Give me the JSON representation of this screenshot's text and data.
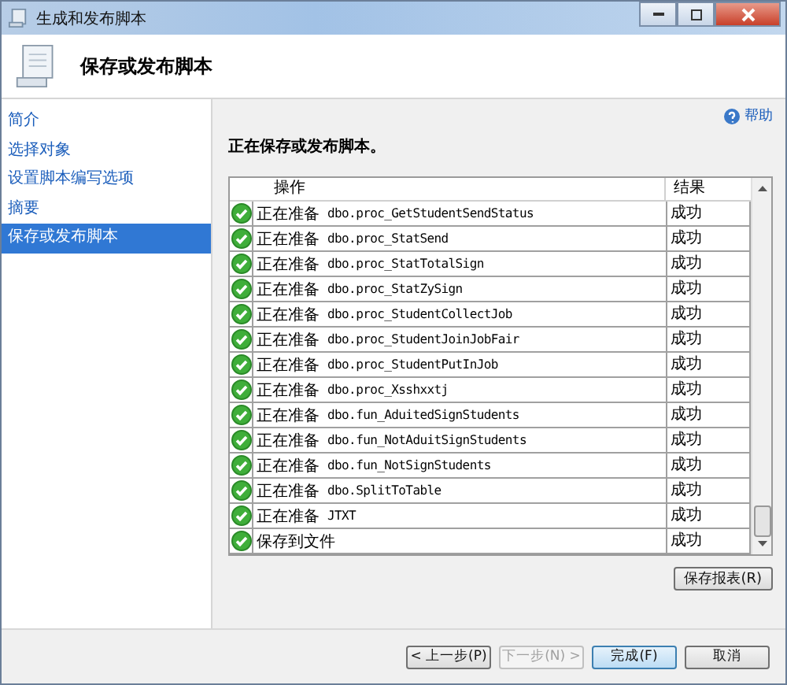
{
  "window": {
    "title": "生成和发布脚本"
  },
  "header": {
    "title": "保存或发布脚本"
  },
  "sidebar": {
    "items": [
      {
        "label": "简介",
        "selected": false
      },
      {
        "label": "选择对象",
        "selected": false
      },
      {
        "label": "设置脚本编写选项",
        "selected": false
      },
      {
        "label": "摘要",
        "selected": false
      },
      {
        "label": "保存或发布脚本",
        "selected": true
      }
    ]
  },
  "help": "帮助",
  "heading": "正在保存或发布脚本。",
  "table": {
    "columns": [
      "操作",
      "结果"
    ],
    "rows": [
      {
        "succeeded": true,
        "action": "正在准备",
        "object": "dbo.proc_GetStudentSendStatus",
        "result": "成功"
      },
      {
        "succeeded": true,
        "action": "正在准备",
        "object": "dbo.proc_StatSend",
        "result": "成功"
      },
      {
        "succeeded": true,
        "action": "正在准备",
        "object": "dbo.proc_StatTotalSign",
        "result": "成功"
      },
      {
        "succeeded": true,
        "action": "正在准备",
        "object": "dbo.proc_StatZySign",
        "result": "成功"
      },
      {
        "succeeded": true,
        "action": "正在准备",
        "object": "dbo.proc_StudentCollectJob",
        "result": "成功"
      },
      {
        "succeeded": true,
        "action": "正在准备",
        "object": "dbo.proc_StudentJoinJobFair",
        "result": "成功"
      },
      {
        "succeeded": true,
        "action": "正在准备",
        "object": "dbo.proc_StudentPutInJob",
        "result": "成功"
      },
      {
        "succeeded": true,
        "action": "正在准备",
        "object": "dbo.proc_Xsshxxtj",
        "result": "成功"
      },
      {
        "succeeded": true,
        "action": "正在准备",
        "object": "dbo.fun_AduitedSignStudents",
        "result": "成功"
      },
      {
        "succeeded": true,
        "action": "正在准备",
        "object": "dbo.fun_NotAduitSignStudents",
        "result": "成功"
      },
      {
        "succeeded": true,
        "action": "正在准备",
        "object": "dbo.fun_NotSignStudents",
        "result": "成功"
      },
      {
        "succeeded": true,
        "action": "正在准备",
        "object": "dbo.SplitToTable",
        "result": "成功"
      },
      {
        "succeeded": true,
        "action": "正在准备",
        "object": "JTXT",
        "result": "成功"
      },
      {
        "succeeded": true,
        "action": "保存到文件",
        "result": "成功"
      }
    ]
  },
  "save_report": "保存报表(R)",
  "buttons": [
    {
      "label": "< 上一步(P)",
      "disabled": false,
      "default": false
    },
    {
      "label": "下一步(N) >",
      "disabled": true,
      "default": false
    },
    {
      "label": "完成(F)",
      "disabled": false,
      "default": true
    },
    {
      "label": "取消",
      "disabled": false,
      "default": false
    }
  ]
}
